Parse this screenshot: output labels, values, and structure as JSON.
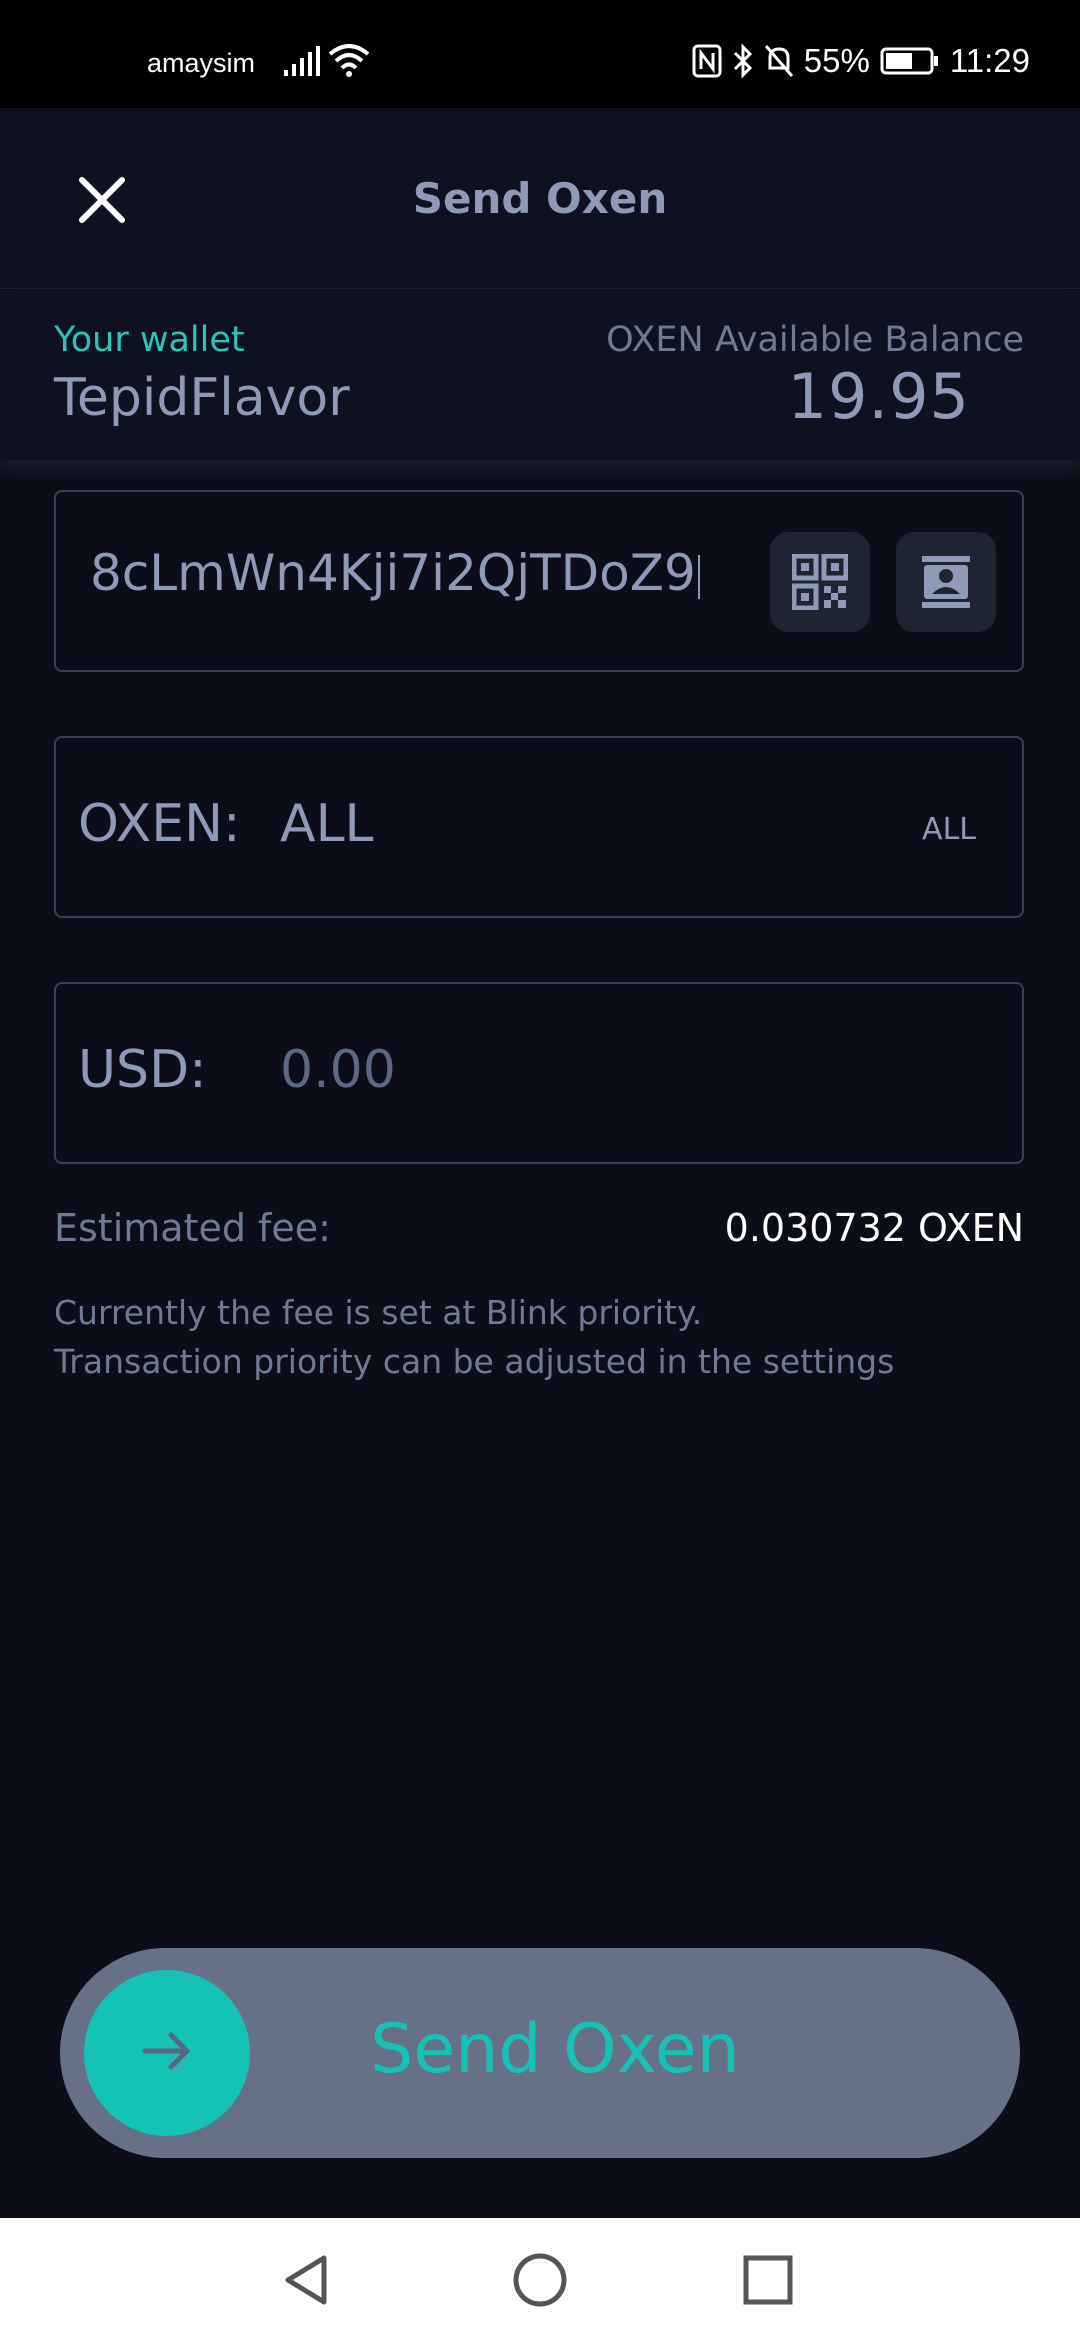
{
  "status_bar": {
    "carrier": "amaysim",
    "battery": "55%",
    "time": "11:29",
    "icons": [
      "signal-icon",
      "wifi-icon",
      "nfc-icon",
      "bluetooth-icon",
      "bell-off-icon",
      "battery-icon"
    ]
  },
  "header": {
    "title": "Send Oxen",
    "close_icon": "close-icon"
  },
  "wallet": {
    "label": "Your wallet",
    "name": "TepidFlavor",
    "balance_label": "OXEN Available Balance",
    "balance": "19.95"
  },
  "address": {
    "value": "8cLmWn4Kji7i2QjTDoZ9",
    "qr_icon": "qr-code-icon",
    "contacts_icon": "contacts-icon"
  },
  "oxen_amount": {
    "label": "OXEN:",
    "value": "ALL",
    "all_button": "ALL"
  },
  "usd_amount": {
    "label": "USD:",
    "placeholder": "0.00"
  },
  "fee": {
    "label": "Estimated fee:",
    "value": "0.030732 OXEN",
    "note_line1": "Currently the fee is set at Blink priority.",
    "note_line2": "Transaction priority can be adjusted in the settings"
  },
  "send": {
    "label": "Send Oxen",
    "knob_icon": "arrow-right-icon"
  },
  "colors": {
    "background": "#0b0e18",
    "accent": "#14c3b6",
    "text": "#8e9ab8",
    "slider": "#667188"
  }
}
